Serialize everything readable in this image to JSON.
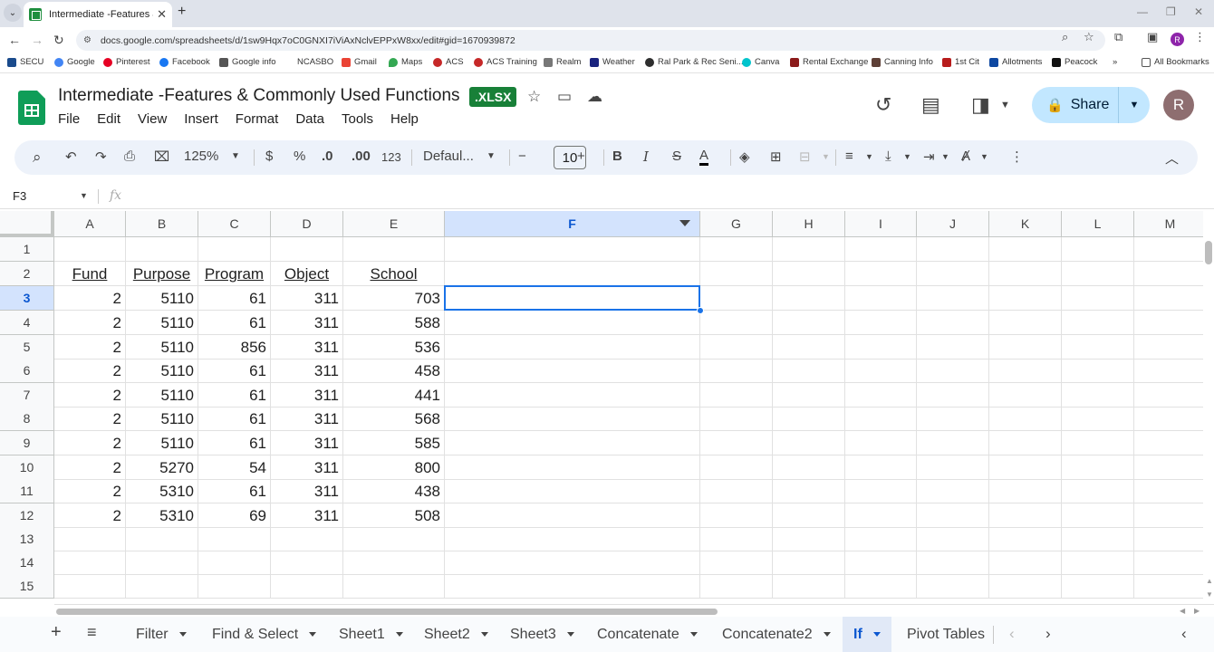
{
  "browser": {
    "tab_title": "Intermediate -Features & Com",
    "url": "docs.google.com/spreadsheets/d/1sw9Hqx7oC0GNXI7iViAxNclvEPPxW8xx/edit#gid=1670939872",
    "profile_initial": "R",
    "bookmarks": [
      "SECU",
      "Google",
      "Pinterest",
      "Facebook",
      "Google info",
      "NCASBO",
      "Gmail",
      "Maps",
      "ACS",
      "ACS Training",
      "Realm",
      "Weather",
      "Ral Park & Rec Seni...",
      "Canva",
      "Rental Exchange",
      "Canning Info",
      "1st Cit",
      "Allotments",
      "Peacock"
    ],
    "all_bookmarks": "All Bookmarks"
  },
  "doc": {
    "title": "Intermediate -Features & Commonly Used Functions",
    "badge": ".XLSX",
    "menus": [
      "File",
      "Edit",
      "View",
      "Insert",
      "Format",
      "Data",
      "Tools",
      "Help"
    ],
    "share_label": "Share",
    "avatar_initial": "R"
  },
  "toolbar": {
    "zoom": "125%",
    "currency": "$",
    "percent": "%",
    "dec_decrease": ".0",
    "dec_increase": ".00",
    "number_format": "123",
    "font": "Defaul...",
    "font_size": "10",
    "bold": "B",
    "italic": "I",
    "strike": "S",
    "text_color": "A"
  },
  "formula_bar": {
    "name_box": "F3",
    "fx": "fx",
    "formula": ""
  },
  "grid": {
    "columns": [
      "A",
      "B",
      "C",
      "D",
      "E",
      "F",
      "G",
      "H",
      "I",
      "J",
      "K",
      "L",
      "M"
    ],
    "selected_column": "F",
    "selected_row": "3",
    "rows": [
      "1",
      "2",
      "3",
      "4",
      "5",
      "6",
      "7",
      "8",
      "9",
      "10",
      "11",
      "12",
      "13",
      "14",
      "15"
    ],
    "headers": [
      "Fund",
      "Purpose",
      "Program",
      "Object",
      "School"
    ],
    "data": [
      [
        "2",
        "5110",
        "61",
        "311",
        "703"
      ],
      [
        "2",
        "5110",
        "61",
        "311",
        "588"
      ],
      [
        "2",
        "5110",
        "856",
        "311",
        "536"
      ],
      [
        "2",
        "5110",
        "61",
        "311",
        "458"
      ],
      [
        "2",
        "5110",
        "61",
        "311",
        "441"
      ],
      [
        "2",
        "5110",
        "61",
        "311",
        "568"
      ],
      [
        "2",
        "5110",
        "61",
        "311",
        "585"
      ],
      [
        "2",
        "5270",
        "54",
        "311",
        "800"
      ],
      [
        "2",
        "5310",
        "61",
        "311",
        "438"
      ],
      [
        "2",
        "5310",
        "69",
        "311",
        "508"
      ]
    ]
  },
  "sheets": {
    "tabs": [
      "Filter",
      "Find & Select",
      "Sheet1",
      "Sheet2",
      "Sheet3",
      "Concatenate",
      "Concatenate2",
      "If",
      "Pivot Tables"
    ],
    "active": "If"
  },
  "colors": {
    "accent": "#1a73e8",
    "share_bg": "#c2e7ff",
    "xlsx_badge": "#188038",
    "selection_header": "#d3e3fd"
  }
}
